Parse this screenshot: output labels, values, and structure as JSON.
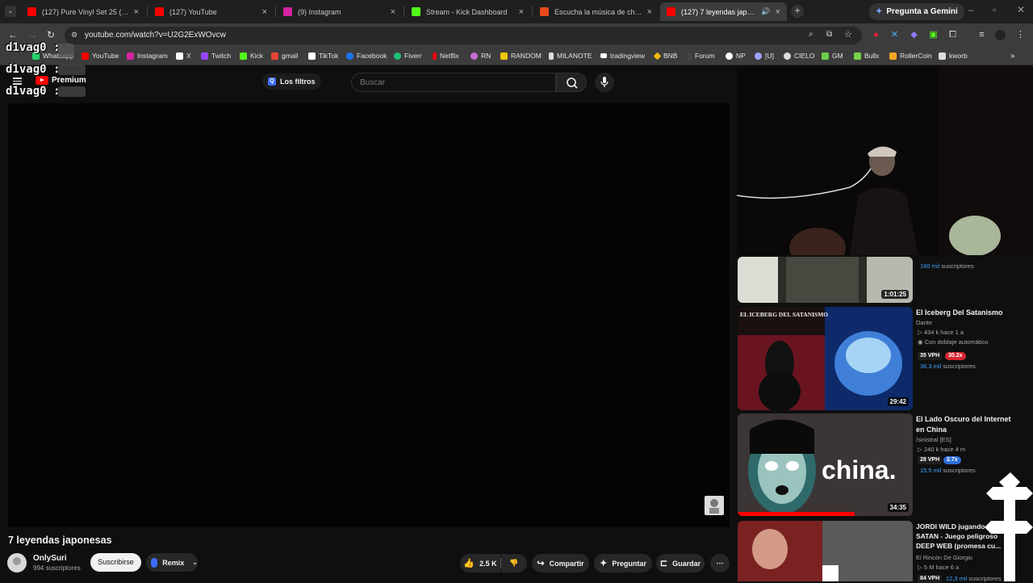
{
  "browser": {
    "tabs": [
      {
        "title": "(127) Pure Vinyl Set 25 (Classic",
        "icon": "youtube-icon",
        "color": "#ff0000"
      },
      {
        "title": "(127) YouTube",
        "icon": "youtube-icon",
        "color": "#ff0000"
      },
      {
        "title": "(9) Instagram",
        "icon": "instagram-icon",
        "color": "#d6249f"
      },
      {
        "title": "Stream - Kick Dashboard",
        "icon": "kick-icon",
        "color": "#53fc18"
      },
      {
        "title": "Escucha la música de che | Disk",
        "icon": "music-icon",
        "color": "#e8491d"
      },
      {
        "title": "(127) 7 leyendas japonesas",
        "icon": "youtube-icon",
        "color": "#ff0000"
      }
    ],
    "gemini_label": "Pregunta a Gemini",
    "url": "youtube.com/watch?v=U2G2ExWOvcw",
    "bookmarks": [
      {
        "label": "Whatsapp",
        "color": "#25d366"
      },
      {
        "label": "YouTube",
        "color": "#ff0000"
      },
      {
        "label": "Instagram",
        "color": "#d6249f"
      },
      {
        "label": "X",
        "color": "#ffffff"
      },
      {
        "label": "Twitch",
        "color": "#9146ff"
      },
      {
        "label": "Kick",
        "color": "#53fc18"
      },
      {
        "label": "gmail",
        "color": "#ea4335"
      },
      {
        "label": "TikTok",
        "color": "#ffffff"
      },
      {
        "label": "Facebook",
        "color": "#1877f2"
      },
      {
        "label": "Fiverr",
        "color": "#1dbf73"
      },
      {
        "label": "Netflix",
        "color": "#e50914"
      },
      {
        "label": "RN",
        "color": "#c86bd6"
      },
      {
        "label": "RANDOM",
        "color": "#f1c40f"
      },
      {
        "label": "MILANOTE",
        "color": "#dddddd"
      },
      {
        "label": "tradingview",
        "color": "#ffffff"
      },
      {
        "label": "BNB",
        "color": "#f0b90b"
      },
      {
        "label": "Forum",
        "color": "#444444"
      },
      {
        "label": "NP",
        "color": "#ffffff"
      },
      {
        "label": "[U]",
        "color": "#9aa6ff"
      },
      {
        "label": "CIELO",
        "color": "#dddddd"
      },
      {
        "label": "GM",
        "color": "#6ad04a"
      },
      {
        "label": "Bullx",
        "color": "#7ad24a"
      },
      {
        "label": "RollerCoin",
        "color": "#f5a623"
      },
      {
        "label": "kworb",
        "color": "#dddddd"
      }
    ]
  },
  "chat": {
    "username": "d1vag0 :",
    "premium_label": "Premium"
  },
  "header": {
    "filters_label": "Los filtros",
    "search_placeholder": "Buscar"
  },
  "video": {
    "title": "7 leyendas japonesas",
    "channel": "OnlySuri",
    "subscribers": "994 suscriptores",
    "subscribe_label": "Suscribirse",
    "remix_label": "Remix",
    "likes": "2.5 K",
    "share_label": "Compartir",
    "ask_label": "Preguntar",
    "save_label": "Guardar"
  },
  "related": [
    {
      "title": "",
      "duration": "1:01:25",
      "vph": "",
      "ratio": "",
      "subs_num": "180 mil",
      "subs_label": " suscriptores"
    },
    {
      "title": "El Iceberg Del Satanismo",
      "channel": "Dante",
      "meta": "434 k  hace 1 a",
      "dub": "Con doblaje automático",
      "duration": "29:42",
      "vph": "35 VPH",
      "ratio": "30.2x",
      "subs_num": "36,3 mil",
      "subs_label": " suscriptores",
      "thumb_text": "EL ICEBERG DEL SATANISMO"
    },
    {
      "title": "El Lado Oscuro del Internet en China",
      "channel": "/sinistral [ES]",
      "meta": "240 k  hace 4 m",
      "duration": "34:35",
      "vph": "28 VPH",
      "ratio": "2.7x",
      "subs_num": "15,5 mil",
      "subs_label": " suscriptores",
      "thumb_text": "china."
    },
    {
      "title": "JORDI WILD jugando a SAN SATAN - Juego peligroso DEEP WEB (promesa cu...",
      "channel": "El Rincón De Giorgio",
      "meta": "5 M  hace 6 a",
      "vph": "84 VPH",
      "subs_num": "12,3 mil",
      "subs_label": " suscriptores"
    }
  ],
  "colors": {
    "background": "#0f0f0f",
    "accent": "#3ea6ff",
    "brand_red": "#ff0000"
  }
}
